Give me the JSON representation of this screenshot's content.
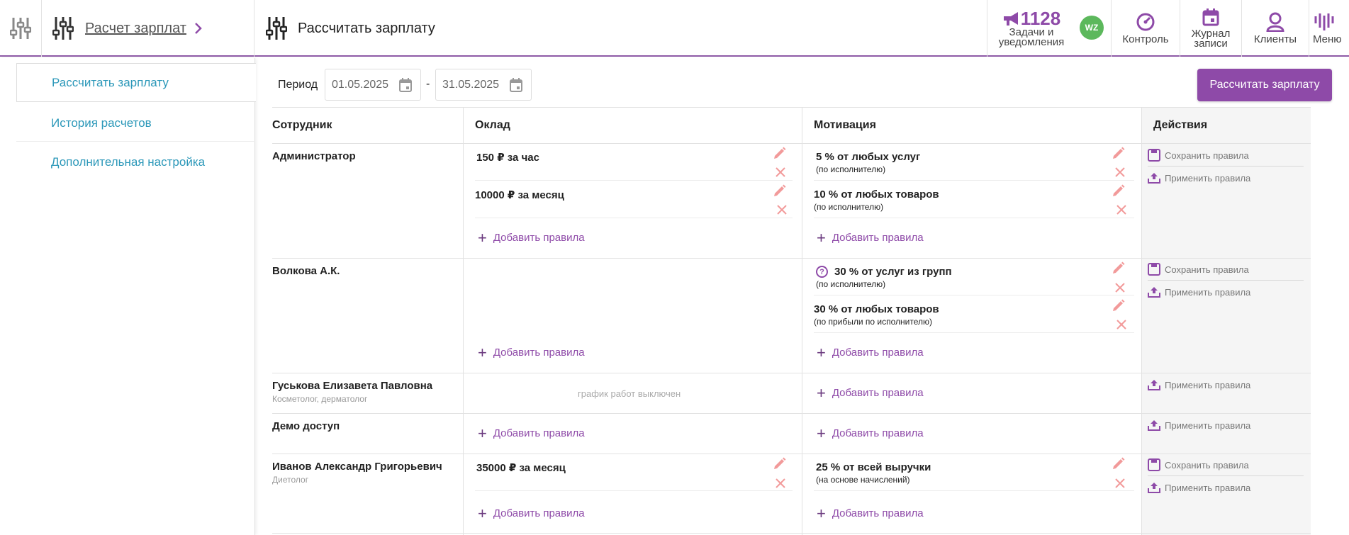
{
  "header": {
    "breadcrumb": "Расчет зарплат",
    "page_title": "Рассчитать зарплату",
    "tasks_count": "1128",
    "tasks_label_1": "Задачи и",
    "tasks_label_2": "уведомления",
    "avatar_initials": "WZ",
    "nav": {
      "control": "Контроль",
      "journal_1": "Журнал",
      "journal_2": "записи",
      "clients": "Клиенты",
      "menu": "Меню"
    },
    "accent_color": "#8e4aa8"
  },
  "sidebar": {
    "items": [
      {
        "label": "Рассчитать зарплату",
        "active": true
      },
      {
        "label": "История расчетов",
        "active": false
      },
      {
        "label": "Дополнительная настройка",
        "active": false
      }
    ]
  },
  "filters": {
    "period_label": "Период",
    "date_from": "01.05.2025",
    "dash": "-",
    "date_to": "31.05.2025",
    "calculate_button": "Рассчитать зарплату"
  },
  "table": {
    "headers": [
      "Сотрудник",
      "Оклад",
      "Мотивация",
      "Действия"
    ],
    "add_rule": "Добавить правила",
    "save_rules": "Сохранить правила",
    "apply_rules": "Применить правила",
    "schedule_off": "график работ выключен",
    "rows": [
      {
        "name": "Администратор",
        "role": "",
        "salary": [
          {
            "main": "150 ₽ за час",
            "sub": ""
          },
          {
            "main": "10000 ₽ за месяц",
            "sub": ""
          }
        ],
        "motivation": [
          {
            "main": "5 % от любых услуг",
            "sub": "(по исполнителю)"
          },
          {
            "main": "10 % от любых товаров",
            "sub": "(по исполнителю)"
          }
        ]
      },
      {
        "name": "Волкова А.К.",
        "role": "",
        "salary": [],
        "motivation": [
          {
            "main": "30 % от услуг из групп",
            "sub": "(по исполнителю)",
            "help": "?"
          },
          {
            "main": "30 % от любых товаров",
            "sub": "(по прибыли по исполнителю)"
          }
        ]
      },
      {
        "name": "Гуськова Елизавета Павловна",
        "role": "Косметолог, дерматолог",
        "salary": [],
        "motivation": []
      },
      {
        "name": "Демо доступ",
        "role": "",
        "salary": [],
        "motivation": []
      },
      {
        "name": "Иванов Александр Григорьевич",
        "role": "Диетолог",
        "salary": [
          {
            "main": "35000 ₽ за месяц",
            "sub": ""
          }
        ],
        "motivation": [
          {
            "main": "25 % от всей выручки",
            "sub": "(на основе начислений)"
          }
        ]
      }
    ]
  }
}
